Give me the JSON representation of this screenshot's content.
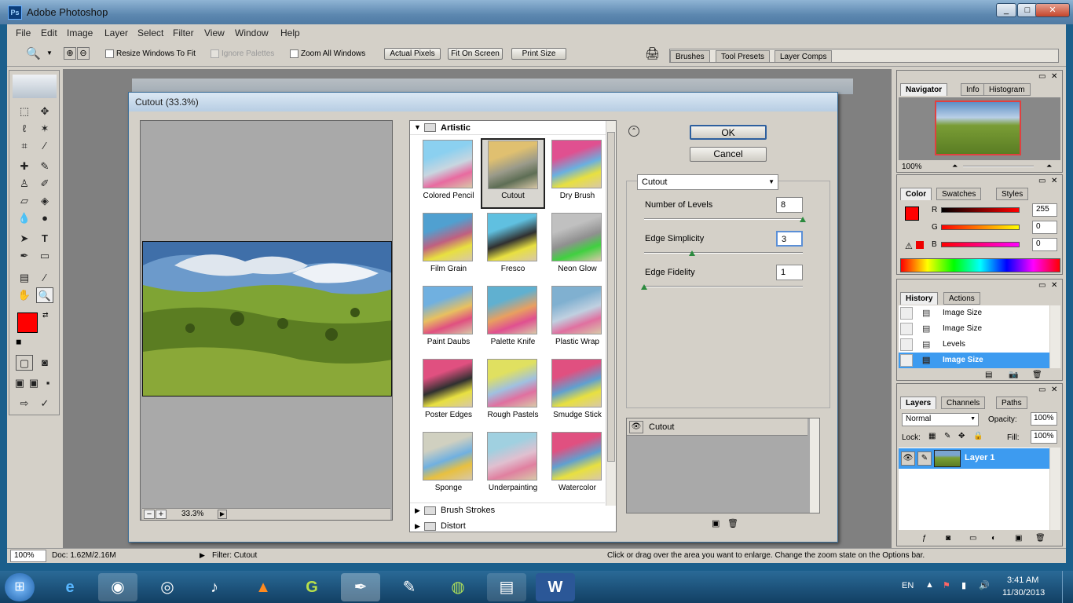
{
  "app": {
    "title": "Adobe Photoshop"
  },
  "menus": [
    "File",
    "Edit",
    "Image",
    "Layer",
    "Select",
    "Filter",
    "View",
    "Window",
    "Help"
  ],
  "options": {
    "resize_windows": "Resize Windows To Fit",
    "ignore_palettes": "Ignore Palettes",
    "zoom_all": "Zoom All Windows",
    "actual_pixels": "Actual Pixels",
    "fit_on_screen": "Fit On Screen",
    "print_size": "Print Size",
    "palette_well_tabs": [
      "Brushes",
      "Tool Presets",
      "Layer Comps"
    ]
  },
  "dialog": {
    "title": "Cutout (33.3%)",
    "ok": "OK",
    "cancel": "Cancel",
    "preview_zoom": "33.3%",
    "zoom_minus": "−",
    "zoom_plus": "+",
    "category_open": "Artistic",
    "filters": [
      "Colored Pencil",
      "Cutout",
      "Dry Brush",
      "Film Grain",
      "Fresco",
      "Neon Glow",
      "Paint Daubs",
      "Palette Knife",
      "Plastic Wrap",
      "Poster Edges",
      "Rough Pastels",
      "Smudge Stick",
      "Sponge",
      "Underpainting",
      "Watercolor"
    ],
    "selected_filter": "Cutout",
    "categories_closed": [
      "Brush Strokes",
      "Distort"
    ],
    "filter_select": "Cutout",
    "params": [
      {
        "label": "Number of Levels",
        "value": "8",
        "fraction": 1.0
      },
      {
        "label": "Edge Simplicity",
        "value": "3",
        "fraction": 0.3
      },
      {
        "label": "Edge Fidelity",
        "value": "1",
        "fraction": 0.0
      }
    ],
    "layers_item": "Cutout"
  },
  "navigator": {
    "tabs": [
      "Navigator",
      "Info",
      "Histogram"
    ],
    "zoom": "100%"
  },
  "color": {
    "tabs": [
      "Color",
      "Swatches",
      "Styles"
    ],
    "labels": [
      "R",
      "G",
      "B"
    ],
    "values": [
      "255",
      "0",
      "0"
    ],
    "fg": "#ff0000"
  },
  "history": {
    "tabs": [
      "History",
      "Actions"
    ],
    "items": [
      "Image Size",
      "Image Size",
      "Levels",
      "Image Size"
    ],
    "selected": 3
  },
  "layers": {
    "tabs": [
      "Layers",
      "Channels",
      "Paths"
    ],
    "mode": "Normal",
    "opacity_label": "Opacity:",
    "opacity": "100%",
    "lock_label": "Lock:",
    "fill_label": "Fill:",
    "fill": "100%",
    "layer_name": "Layer 1"
  },
  "status": {
    "zoom": "100%",
    "doc": "Doc: 1.62M/2.16M",
    "filter": "Filter: Cutout",
    "hint": "Click or drag over the area you want to enlarge. Change the zoom state on the Options bar."
  },
  "taskbar": {
    "lang": "EN",
    "time": "3:41 AM",
    "date": "11/30/2013"
  },
  "colors": {
    "accent": "#3399ff",
    "selection": "#3d9bf0"
  }
}
